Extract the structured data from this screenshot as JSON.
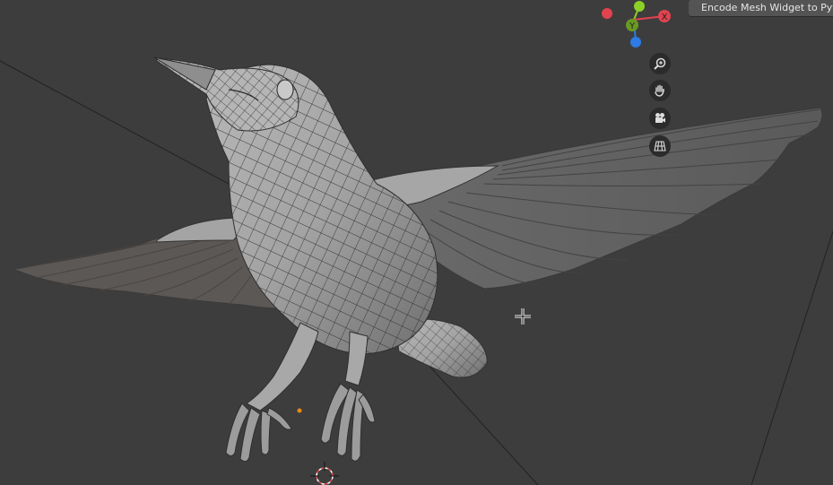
{
  "header": {
    "encode_button_label": "Encode Mesh Widget to Python"
  },
  "navigation_gizmo": {
    "axes": [
      {
        "label": "X",
        "color": "#e2434f"
      },
      {
        "label": "Y",
        "color": "#8bd026"
      },
      {
        "label": "Z",
        "color": "#2d7be5"
      }
    ]
  },
  "viewport_tools": [
    {
      "name": "zoom-icon"
    },
    {
      "name": "hand-pan-icon"
    },
    {
      "name": "camera-icon"
    },
    {
      "name": "grid-toggle-icon"
    }
  ],
  "colors": {
    "background": "#3d3d3d",
    "mesh_fill": "#9a9a9a",
    "wireframe": "#2e2e2e",
    "origin_dot": "#e68a1e",
    "cursor_ring": "#d94a4a"
  },
  "scene": {
    "object": "bird mesh"
  }
}
